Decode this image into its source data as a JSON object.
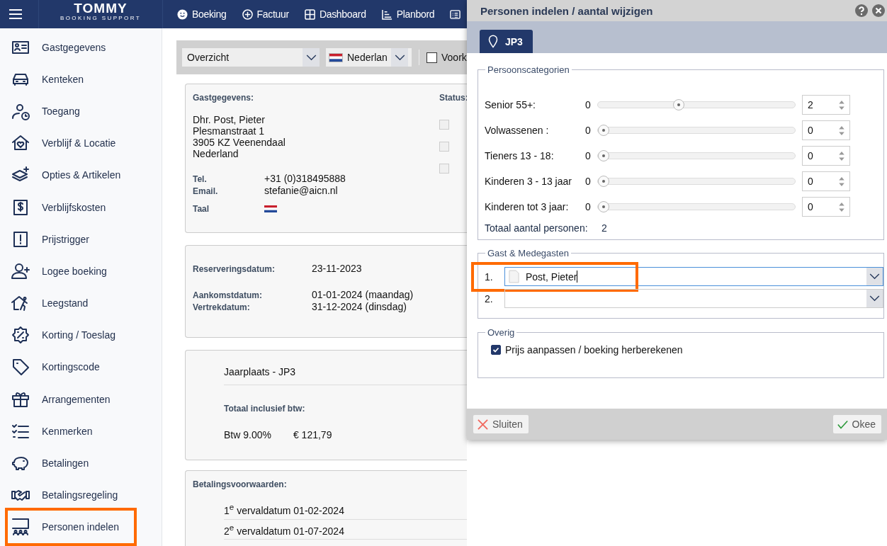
{
  "topbar": {
    "logo": "TOMMY",
    "tagline": "BOOKING SUPPORT",
    "nav": [
      "Boeking",
      "Factuur",
      "Dashboard",
      "Planbord"
    ]
  },
  "sidebar": {
    "items": [
      {
        "label": "Gastgegevens",
        "highlighted": false
      },
      {
        "label": "Kenteken",
        "highlighted": false
      },
      {
        "label": "Toegang",
        "highlighted": false
      },
      {
        "label": "Verblijf & Locatie",
        "highlighted": false
      },
      {
        "label": "Opties & Artikelen",
        "highlighted": false
      },
      {
        "label": "Verblijfskosten",
        "highlighted": false
      },
      {
        "label": "Prijstrigger",
        "highlighted": false
      },
      {
        "label": "Logee boeking",
        "highlighted": false
      },
      {
        "label": "Leegstand",
        "highlighted": false
      },
      {
        "label": "Korting / Toeslag",
        "highlighted": false
      },
      {
        "label": "Kortingscode",
        "highlighted": false
      },
      {
        "label": "Arrangementen",
        "highlighted": false
      },
      {
        "label": "Kenmerken",
        "highlighted": false
      },
      {
        "label": "Betalingen",
        "highlighted": false
      },
      {
        "label": "Betalingsregeling",
        "highlighted": false
      },
      {
        "label": "Personen indelen",
        "highlighted": true
      }
    ]
  },
  "toolbar": {
    "view": "Overzicht",
    "language": "Nederlan",
    "option_label": "Voork",
    "option_checked": false
  },
  "guest_card": {
    "heading": "Gastgegevens:",
    "address": [
      "Dhr. Post, Pieter",
      "Plesmanstraat 1",
      "3905 KZ Veenendaal",
      "Nederland"
    ],
    "contacts": [
      {
        "label": "Tel.",
        "value": "+31 (0)318495888"
      },
      {
        "label": "Email.",
        "value": "stefanie@aicn.nl"
      }
    ],
    "language_label": "Taal",
    "status_label": "Status:",
    "status_checks": [
      {
        "checked": false
      },
      {
        "checked": false
      },
      {
        "checked": false
      }
    ]
  },
  "dates_card": {
    "groups": [
      [
        {
          "label": "Reserveringsdatum:",
          "value": "23-11-2023"
        }
      ],
      [
        {
          "label": "Aankomstdatum:",
          "value": "01-01-2024 (maandag)"
        },
        {
          "label": "Vertrekdatum:",
          "value": "31-12-2024 (dinsdag)"
        }
      ]
    ]
  },
  "price_card": {
    "item": "Jaarplaats - JP3",
    "total_label": "Totaal inclusief btw:",
    "vat_label": "Btw 9.00%",
    "vat_amount": "€ 121,79"
  },
  "payment_card": {
    "heading": "Betalingsvoorwaarden:",
    "terms": [
      "1$^{e}$ vervaldatum 01-02-2024",
      "2$^{e}$ vervaldatum 01-07-2024"
    ]
  },
  "dialog": {
    "title": "Personen indelen / aantal wijzigen",
    "tabs": [
      {
        "label": "JP3",
        "selected": true
      }
    ],
    "categories": {
      "legend": "Persoonscategorien",
      "rows": [
        {
          "label": "Senior 55+:",
          "min": "0",
          "level": 0.4,
          "value": "2"
        },
        {
          "label": "Volwassenen :",
          "min": "0",
          "level": 0,
          "value": "0"
        },
        {
          "label": "Tieners 13 - 18:",
          "min": "0",
          "level": 0,
          "value": "0"
        },
        {
          "label": "Kinderen 3 - 13 jaar",
          "min": "0",
          "level": 0,
          "value": "0"
        },
        {
          "label": "Kinderen tot 3 jaar:",
          "min": "0",
          "level": 0,
          "value": "0"
        }
      ],
      "total_label": "Totaal aantal personen:",
      "total": "2"
    },
    "guests": {
      "legend": "Gast & Medegasten",
      "rows": [
        {
          "number": "1.",
          "value": "Post, Pieter",
          "focused": true,
          "highlighted": true
        },
        {
          "number": "2.",
          "focused": false,
          "highlighted": false
        }
      ]
    },
    "other": {
      "legend": "Overig",
      "option": {
        "label": "Prijs aanpassen / boeking herberekenen",
        "checked": true
      }
    },
    "buttons": {
      "close": "Sluiten",
      "ok": "Okee"
    }
  }
}
